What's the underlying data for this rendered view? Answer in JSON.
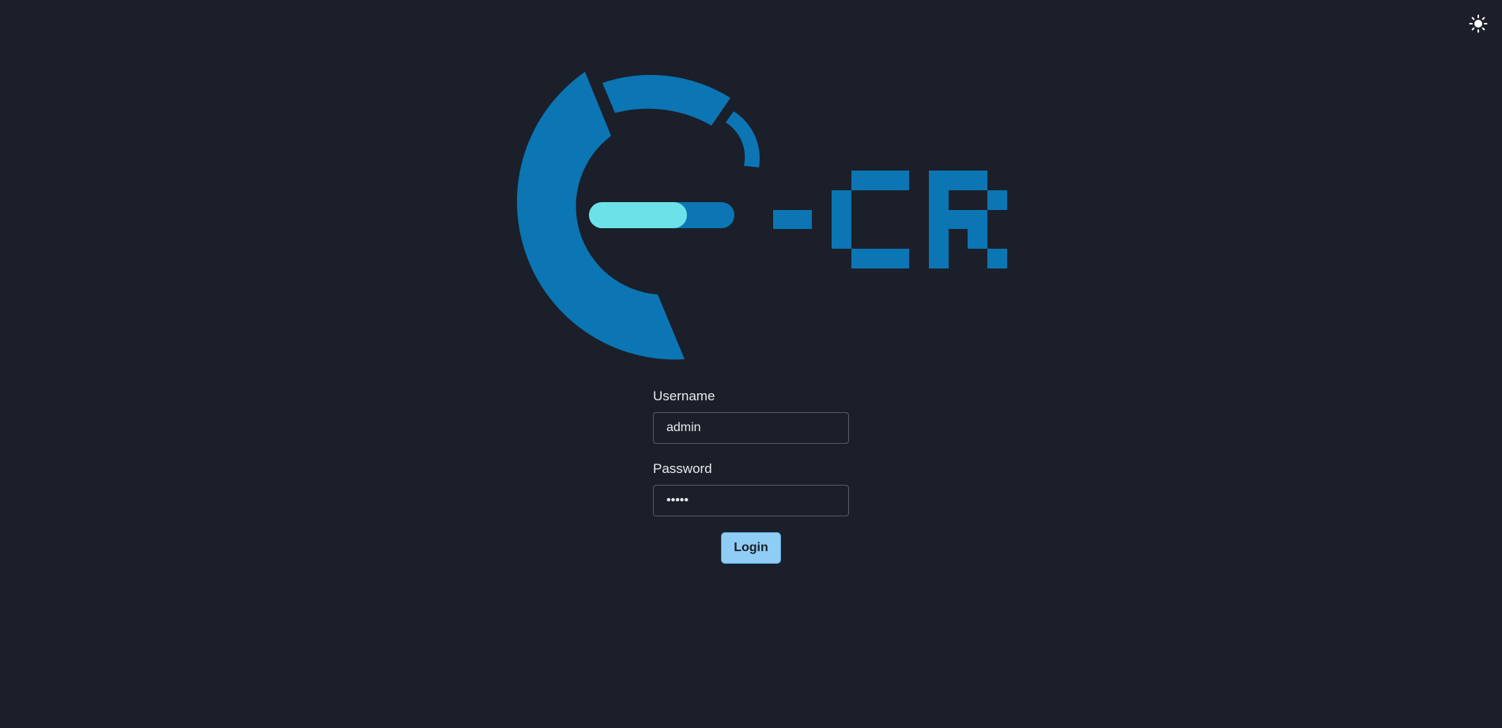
{
  "header": {
    "theme_toggle_icon": "sun-icon"
  },
  "logo": {
    "icon": "e-cr-logo",
    "primary_color": "#0b76b3",
    "accent_color": "#6ce2e8"
  },
  "form": {
    "username_label": "Username",
    "username_value": "admin",
    "password_label": "Password",
    "password_value": "•••••",
    "login_label": "Login"
  },
  "colors": {
    "background": "#1b1f2a",
    "button": "#90cdf4"
  }
}
